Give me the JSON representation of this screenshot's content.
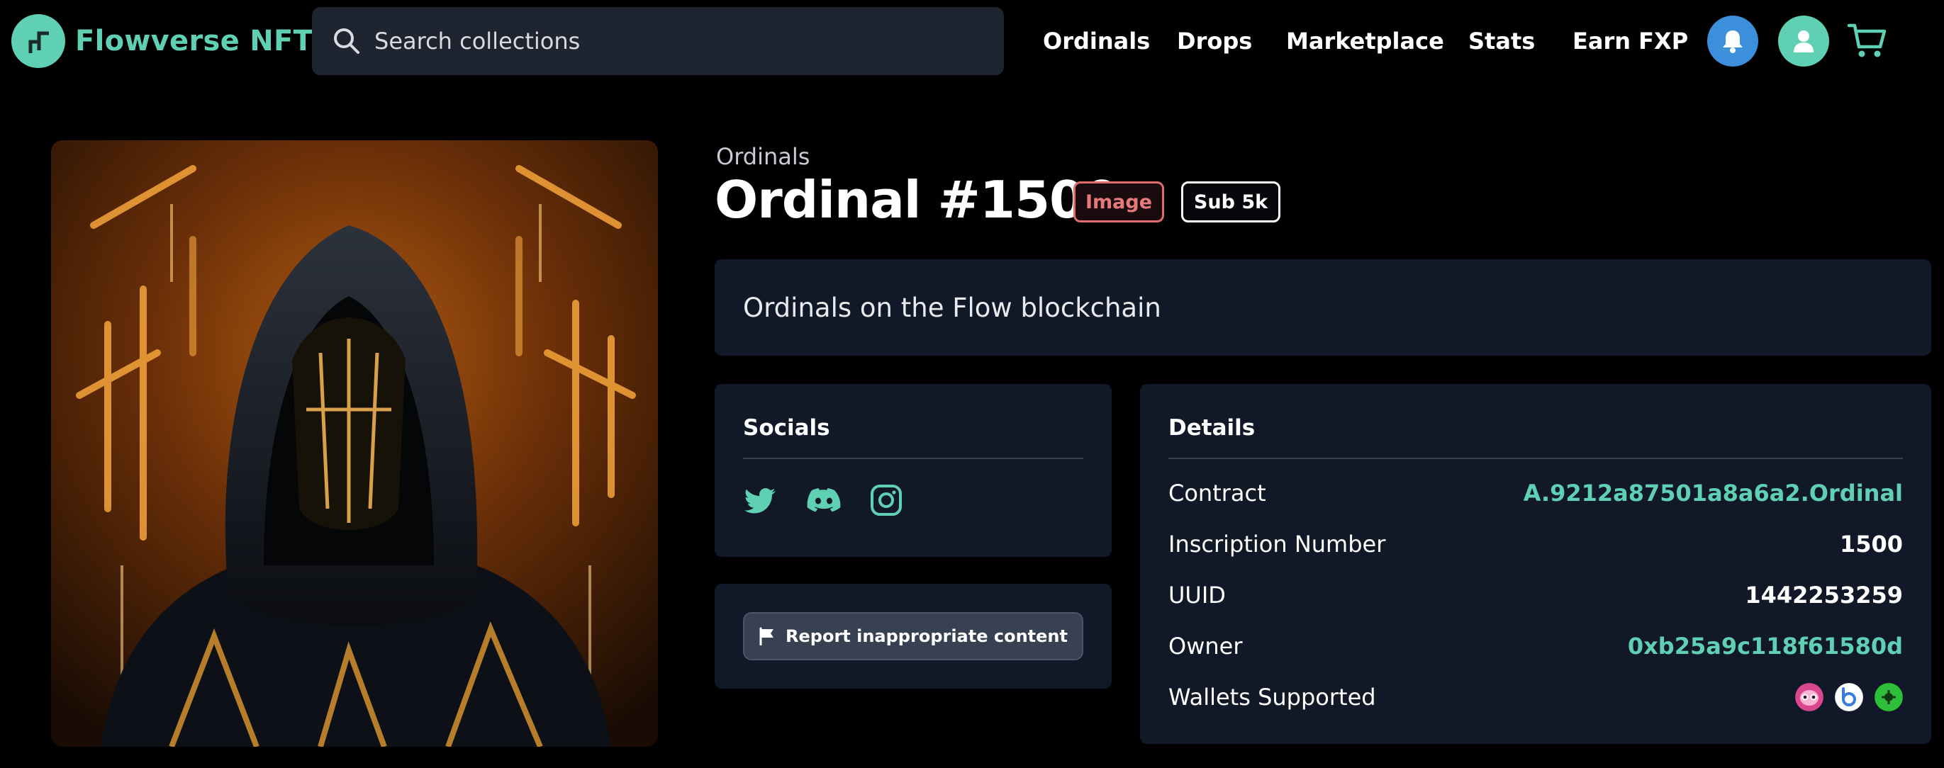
{
  "header": {
    "logo_text": "Flowverse NFT",
    "search_placeholder": "Search collections",
    "nav": [
      "Ordinals",
      "Drops",
      "Marketplace",
      "Stats",
      "Earn FXP"
    ],
    "icons": {
      "notifications": "bell-icon",
      "profile": "user-icon",
      "cart": "cart-icon"
    }
  },
  "nft": {
    "collection": "Ordinals",
    "title": "Ordinal #1500",
    "badges": [
      "Image",
      "Sub 5k"
    ],
    "description": "Ordinals on the Flow blockchain"
  },
  "socials": {
    "title": "Socials",
    "icons": [
      "twitter-icon",
      "discord-icon",
      "instagram-icon"
    ]
  },
  "report": {
    "label": "Report inappropriate content",
    "icon": "flag-icon"
  },
  "details": {
    "title": "Details",
    "rows": [
      {
        "label": "Contract",
        "value": "A.9212a87501a8a6a2.Ordinal"
      },
      {
        "label": "Inscription Number",
        "value": "1500"
      },
      {
        "label": "UUID",
        "value": "1442253259"
      },
      {
        "label": "Owner",
        "value": "0xb25a9c118f61580d"
      }
    ],
    "wallets_label": "Wallets Supported",
    "wallets": [
      "pink-wallet-icon",
      "blue-wallet-icon",
      "green-wallet-icon"
    ]
  },
  "colors": {
    "accent": "#5fd0b3",
    "background": "#000000",
    "panel": "#111827",
    "badge_image": "#e06c6c",
    "bell_button": "#3b8fdb"
  }
}
